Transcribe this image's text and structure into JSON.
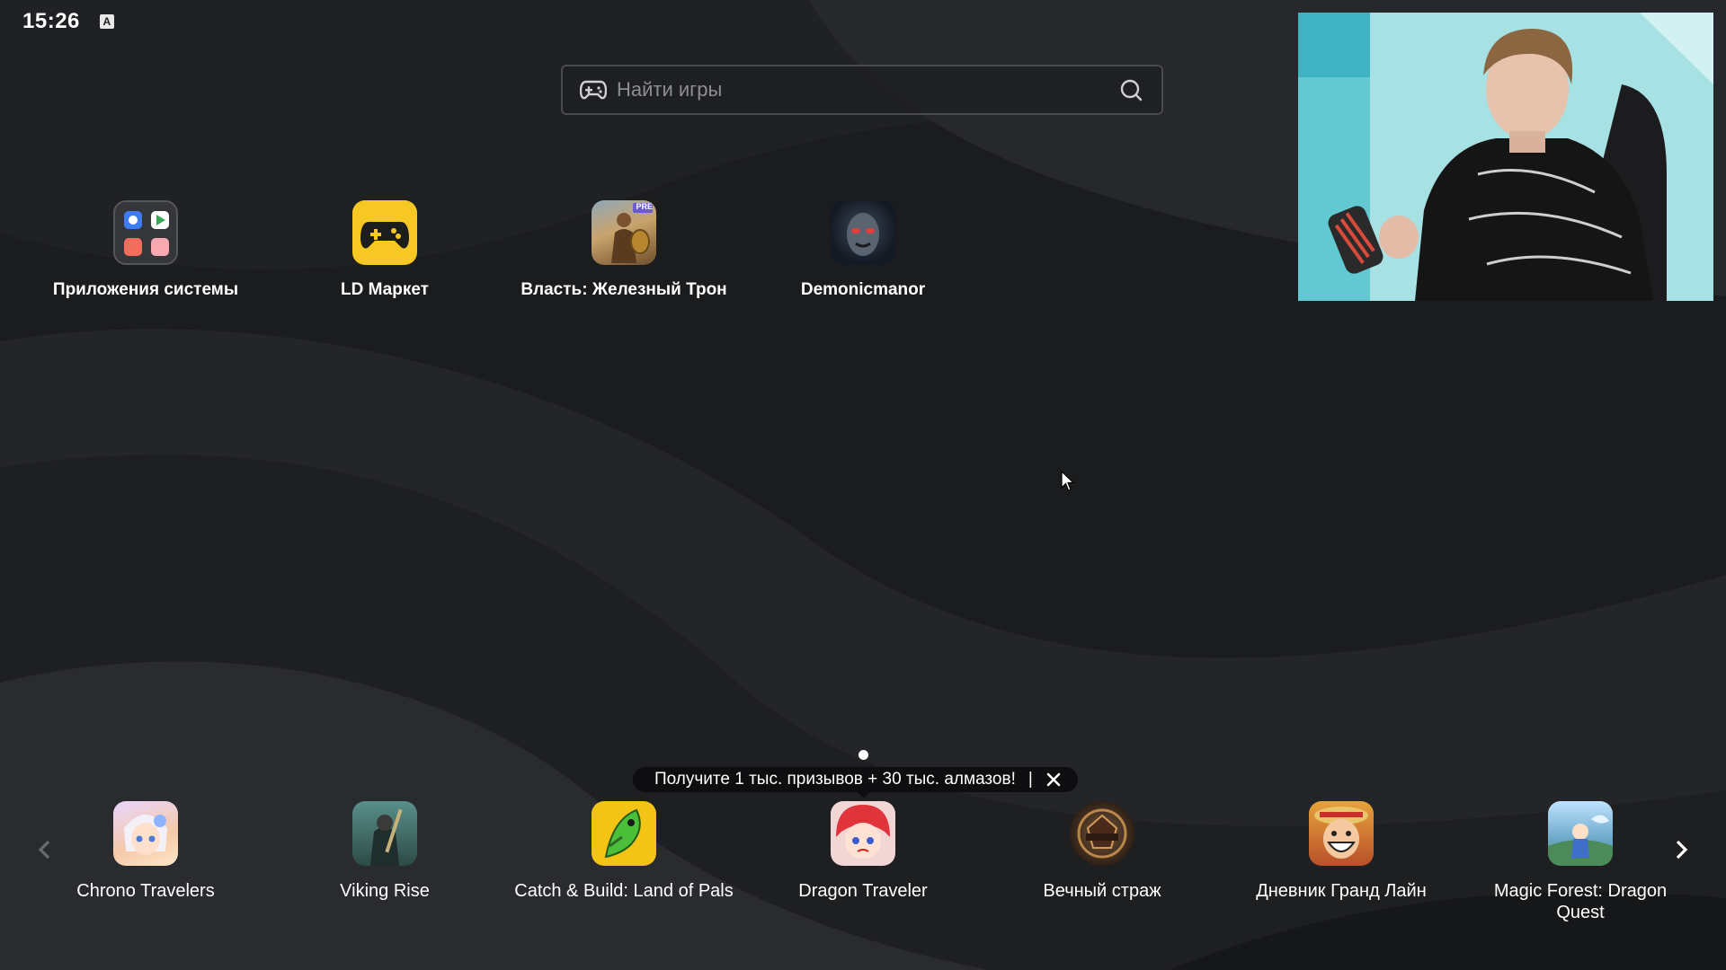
{
  "status_bar": {
    "time": "15:26",
    "indicator": "A"
  },
  "search": {
    "placeholder": "Найти игры"
  },
  "home_apps": [
    {
      "label": "Приложения системы",
      "icon": "system-apps-folder-icon"
    },
    {
      "label": "LD Маркет",
      "icon": "gamepad-icon"
    },
    {
      "label": "Власть: Железный Трон",
      "icon": "game-icon",
      "badge": "PRE"
    },
    {
      "label": "Demonicmanor",
      "icon": "game-icon"
    }
  ],
  "promo_banner": {
    "text": "Получите 1 тыс. призывов + 30 тыс. алмазов!",
    "separator": "|"
  },
  "dock_apps": [
    {
      "label": "Chrono Travelers"
    },
    {
      "label": "Viking Rise"
    },
    {
      "label": "Catch & Build: Land of Pals"
    },
    {
      "label": "Dragon Traveler"
    },
    {
      "label": "Вечный страж"
    },
    {
      "label": "Дневник Гранд Лайн"
    },
    {
      "label": "Magic Forest: Dragon Quest"
    }
  ],
  "pagination": {
    "current_page": 1,
    "total_pages": 1
  },
  "colors": {
    "background": "#1b1c1e",
    "ld_market_accent": "#f7c823",
    "search_border": "#4a4b4f"
  }
}
